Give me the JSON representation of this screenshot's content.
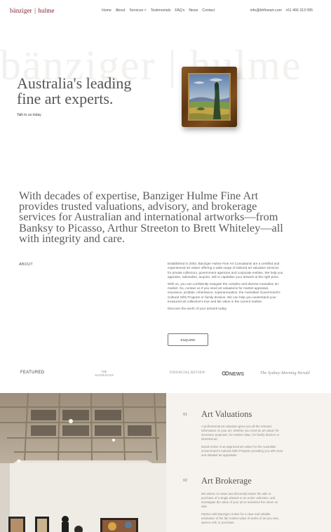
{
  "header": {
    "logo_left": "bänziger",
    "logo_sep": "|",
    "logo_right": "hulme",
    "nav": [
      "Home",
      "About",
      "Services",
      "Testimonials",
      "FAQ's",
      "News",
      "Contact"
    ],
    "services_chevron": "˅",
    "email": "info@bhfineart.com",
    "phone": "+61 466 313 095"
  },
  "hero": {
    "watermark": "bänziger | hulme",
    "title_line1": "Australia's leading",
    "title_line2": "fine art experts.",
    "talk_link": "Talk to us today"
  },
  "statement": "With decades of expertise, Banziger Hulme Fine Art provides trusted valuations, advisory, and brokerage services for Australian and international artworks—from Banksy to Picasso, Arthur Streeton to Brett Whiteley—all with integrity and care.",
  "about": {
    "label": "ABOUT",
    "para1": "Established in 2003, Banziger Hulme Fine Art Consultants are a certified and experienced art valuer offering a wide range of tailored art valuation services for private collectors, government agencies and corporate entities. We help you appraise, rationalise, acquire, sell or capitalise your artwork at the right price.",
    "para2": "With us, you can confidently navigate the complex and diverse Australian art market. So, contact us if you need art valuations for market appraisal, insurance, probate, inheritance, superannuation, the Australian Government's Cultural Gifts Program or family division. We can help you understand your treasured art collection's true and fair value in the current market.",
    "para3": "Discover the worth of your artwork today.",
    "button": "ENQUIRE"
  },
  "featured": {
    "label": "FEATURED",
    "press": {
      "australian_top": "THE",
      "australian_bottom": "AUSTRALIAN",
      "financial_review": "FINANCIAL REVIEW",
      "abc_news": "NEWS",
      "smh": "The Sydney Morning Herald"
    }
  },
  "services": [
    {
      "num": "01",
      "title": "Art Valuations",
      "para1": "A professional art valuation gives you all the relevant information on your art, whether you need an art valuer for insurance purposes, for market value, for family division or inherited art.",
      "para2": "David Hulme is an approved art valuer for the Australian Government's Cultural Gifts Program providing you with clear and detailed art appraisals."
    },
    {
      "num": "02",
      "title": "Art Brokerage",
      "para1": "We advise on value and discreetly broker the sale or purchase of a single artwork or an entire collection, and investigate the value of your art to maximise the return on sale.",
      "para2": "Partner with Banziger Hulme for a clear and reliable estimation of the fair market value of works of art you own, want to sell, or purchase."
    }
  ],
  "colors": {
    "logo": "#7a1f2b",
    "services_bg": "#f6f3ef"
  }
}
